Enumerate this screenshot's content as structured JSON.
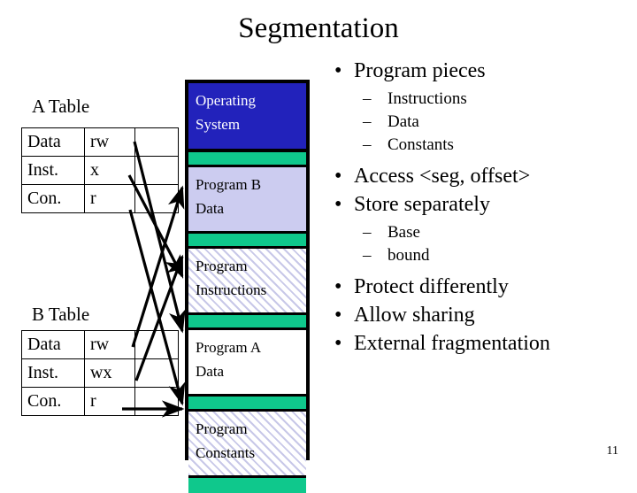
{
  "slide": {
    "title": "Segmentation",
    "page_number": "11"
  },
  "tables": [
    {
      "caption": "A Table",
      "rows": [
        {
          "segment": "Data",
          "perms": "rw",
          "blank": ""
        },
        {
          "segment": "Inst.",
          "perms": "x",
          "blank": ""
        },
        {
          "segment": "Con.",
          "perms": "r",
          "blank": ""
        }
      ]
    },
    {
      "caption": "B Table",
      "rows": [
        {
          "segment": "Data",
          "perms": "rw",
          "blank": ""
        },
        {
          "segment": "Inst.",
          "perms": "wx",
          "blank": ""
        },
        {
          "segment": "Con.",
          "perms": "r",
          "blank": ""
        }
      ]
    }
  ],
  "memory": {
    "blocks": [
      {
        "id": "operating-system",
        "line1": "Operating",
        "line2": "System",
        "fill": "#2222BB",
        "text_color": "#FFFFFF",
        "kind": "solid"
      },
      {
        "id": "free-gap-1",
        "line1": "",
        "line2": "",
        "fill": "#0FC88C",
        "kind": "gap"
      },
      {
        "id": "program-b-data",
        "line1": "Program B",
        "line2": "Data",
        "fill": "#CCCCF0",
        "text_color": "#000000",
        "kind": "solid"
      },
      {
        "id": "free-gap-2",
        "line1": "",
        "line2": "",
        "fill": "#0FC88C",
        "kind": "gap"
      },
      {
        "id": "program-instructions",
        "line1": "Program",
        "line2": "Instructions",
        "fill": "#C8C8E8",
        "text_color": "#000000",
        "kind": "hatched"
      },
      {
        "id": "free-gap-3",
        "line1": "",
        "line2": "",
        "fill": "#0FC88C",
        "kind": "gap"
      },
      {
        "id": "program-a-data",
        "line1": "Program A",
        "line2": "Data",
        "fill": "#FFFFFF",
        "text_color": "#000000",
        "kind": "solid"
      },
      {
        "id": "free-gap-4",
        "line1": "",
        "line2": "",
        "fill": "#0FC88C",
        "kind": "gap"
      },
      {
        "id": "program-constants",
        "line1": "Program",
        "line2": "Constants",
        "fill": "#C8C8E8",
        "text_color": "#000000",
        "kind": "hatched"
      },
      {
        "id": "free-gap-5",
        "line1": "",
        "line2": "",
        "fill": "#0FC88C",
        "kind": "gap"
      }
    ]
  },
  "bullets": {
    "l1_program_pieces": "Program pieces",
    "l2_instructions": "Instructions",
    "l2_data": "Data",
    "l2_constants": "Constants",
    "l1_access": "Access <seg, offset>",
    "l1_store": "Store separately",
    "l2_base": "Base",
    "l2_bound": "bound",
    "l1_protect": "Protect differently",
    "l1_allow_sharing": "Allow sharing",
    "l1_external_frag": "External fragmentation",
    "bullet_glyph": "•",
    "dash_glyph": "–"
  }
}
